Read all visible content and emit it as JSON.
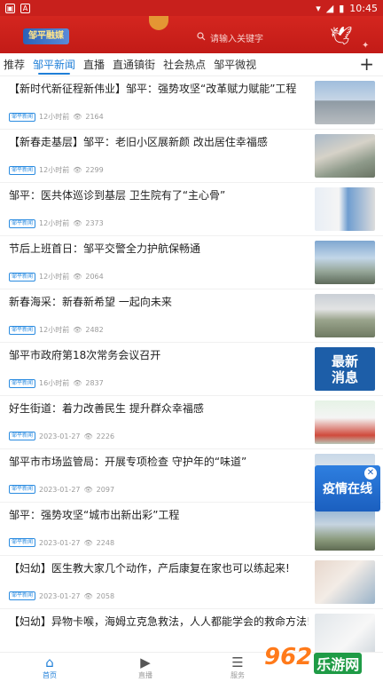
{
  "status_bar": {
    "time": "10:45"
  },
  "header": {
    "logo_text": "邹平融媒",
    "search_placeholder": "请输入关键字"
  },
  "tabs": [
    "推荐",
    "邹平新闻",
    "直播",
    "直通镇街",
    "社会热点",
    "邹平微视"
  ],
  "articles": [
    {
      "title": "【新时代新征程新伟业】邹平：强势攻坚“改革赋力赋能”工程",
      "source": "邹平新闻",
      "time": "12小时前",
      "views": "2164"
    },
    {
      "title": "【新春走基层】邹平：老旧小区展新颜 改出居住幸福感",
      "source": "邹平新闻",
      "time": "12小时前",
      "views": "2299"
    },
    {
      "title": "邹平：医共体巡诊到基层 卫生院有了“主心骨”",
      "source": "邹平新闻",
      "time": "12小时前",
      "views": "2373"
    },
    {
      "title": "节后上班首日：邹平交警全力护航保畅通",
      "source": "邹平新闻",
      "time": "12小时前",
      "views": "2064"
    },
    {
      "title": "新春海采：新春新希望 一起向未来",
      "source": "邹平新闻",
      "time": "12小时前",
      "views": "2482"
    },
    {
      "title": "邹平市政府第18次常务会议召开",
      "source": "邹平新闻",
      "time": "16小时前",
      "views": "2837",
      "thumb_text_1": "最新",
      "thumb_text_2": "消息"
    },
    {
      "title": "好生街道：着力改善民生 提升群众幸福感",
      "source": "邹平新闻",
      "time": "2023-01-27",
      "views": "2226"
    },
    {
      "title": "邹平市市场监管局：开展专项检查 守护年的“味道”",
      "source": "邹平新闻",
      "time": "2023-01-27",
      "views": "2097"
    },
    {
      "title": "邹平：强势攻坚“城市出新出彩”工程",
      "source": "邹平新闻",
      "time": "2023-01-27",
      "views": "2248"
    },
    {
      "title": "【妇幼】医生教大家几个动作，产后康复在家也可以练起来!",
      "source": "邹平新闻",
      "time": "2023-01-27",
      "views": "2058"
    },
    {
      "title": "【妇幼】异物卡喉，海姆立克急救法，人人都能学会的救命方法!",
      "source": "",
      "time": "",
      "views": ""
    }
  ],
  "floating_badge": "疫情在线",
  "bottom_nav": [
    "首页",
    "直播",
    "服务"
  ],
  "watermark": {
    "number": "962",
    "text": "乐游网"
  }
}
